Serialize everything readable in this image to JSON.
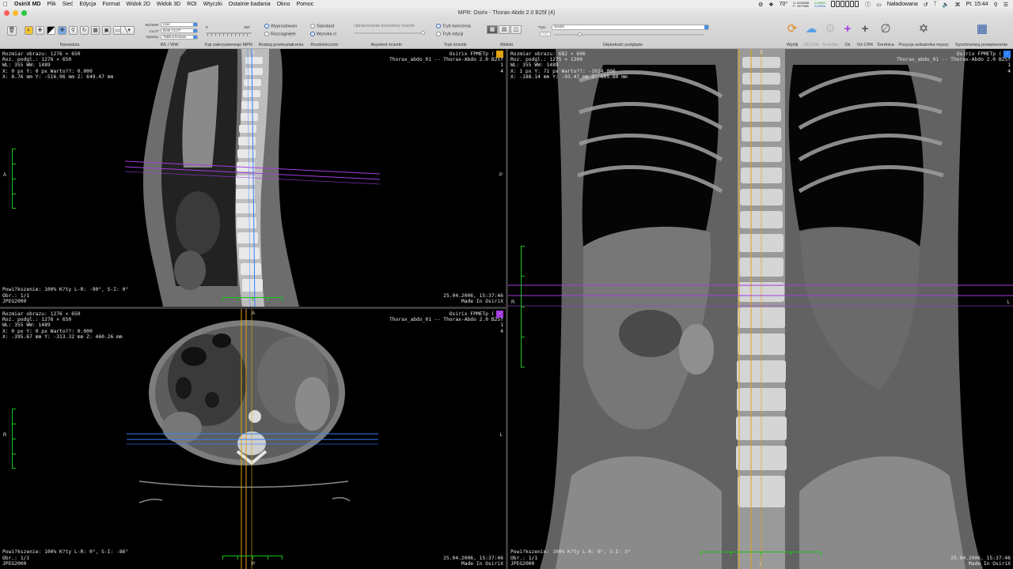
{
  "menubar": {
    "apple": "",
    "app": "OsiriX MD",
    "items": [
      "Plik",
      "Sieć",
      "Edycja",
      "Format",
      "Widok 2D",
      "Widok 3D",
      "ROI",
      "Wtyczki",
      "Ostatnie badania",
      "Okno",
      "Pomoc"
    ],
    "status": {
      "temperature": "70°",
      "mem_u": "U: 6220MB",
      "mem_f": "F: 1977MB",
      "net_up": "0,0KB/s",
      "net_down": "0,0KB/s",
      "battery": "Naładowana",
      "clock": "Pt. 15:44"
    }
  },
  "window": {
    "title": "MPR: Osirix - Thorax-Abdo 2.0 B25f (4)"
  },
  "toolbar": {
    "groups": {
      "tools": "Narzędzia",
      "wlww": "WL / WW",
      "mpr_angle": "Kąt zakrzywionego MPR",
      "resample": "Rodzaj przekształcenia",
      "resolution": "Rozdzielczość",
      "path_assistant": "Asystent ścieżki",
      "path_mode": "Tryb ścieżki",
      "views": "Widoki",
      "depth": "Głębokość podglądu",
      "export": "Wyślij",
      "dicom": "DICOM",
      "path": "Ścieżka",
      "axes": "Oś",
      "cpr_axis": "Oś CPR",
      "diameter": "Średnica",
      "mouse_pos": "Pozycja wskaźnika myszy",
      "sync": "Synchronizuj powiększenie"
    },
    "wlww": {
      "wlww_label": "WL/WW:",
      "wlww_value": "Inne",
      "clut_label": "CLUT:",
      "clut_value": "Brak CLUT",
      "opacity_label": "Opacity:",
      "opacity_value": "Tablica liniowa"
    },
    "slider": {
      "min": "0",
      "max": "360"
    },
    "resample": {
      "opt1": "Wyprostowan",
      "opt2": "Rozciągnięte"
    },
    "resolution": {
      "opt1": "Standard",
      "opt2": "Wysoka rc"
    },
    "path_assistant_text": "Upraszczanie krzywizny ścieżki",
    "path_mode": {
      "opt1": "Tryb tworzenia",
      "opt2": "Tryb edycji"
    },
    "depth": {
      "mode_label": "Tryb:",
      "mode_value": "Średni",
      "sub_value": "mm"
    }
  },
  "viewports": {
    "sagittal": {
      "tl": "Rozmiar obrazu: 1276 × 650\nRoz. podgl.: 1276 × 650\nWL: 355 WW: 1489\nX: 0 px Y: 0 px Warto??: 0.000\nX: 8.76 mm Y: -516.96 mm Z: 649.47 mm",
      "tr": "Osirix FPMETp ( -,\nThorax_abdo_01 -- Thorax-Abdo 2.0 B25f\n1\n4",
      "bl": "Powi?kszenie: 100% K?ty L-R: -90°, S-I: 0°\nObr.: 1/1\nJPEG2000",
      "br": "25.04.2006, 15:37:46\nMade In OsiriX",
      "top": "S",
      "left": "A",
      "right": "P",
      "bottom": "I"
    },
    "axial": {
      "tl": "Rozmiar obrazu: 1276 × 650\nRoz. podgl.: 1276 × 650\nWL: 355 WW: 1489\nX: 0 px Y: 0 px Warto??: 0.000\nX: -395.67 mm Y: -313.32 mm Z: 460.26 mm",
      "tr": "Osirix FPMETp ( -,\nThorax_abdo_01 -- Thorax-Abdo 2.0 B25f\n1\n4",
      "bl": "Powi?kszenie: 100% K?ty L-R: 0°, S-I: -86°\nObr.: 1/1\nJPEG2000",
      "br": "25.04.2006, 15:37:46\nMade In OsiriX",
      "top": "A",
      "left": "R",
      "right": "L",
      "bottom": "P"
    },
    "coronal": {
      "tl": "Rozmiar obrazu: 682 × 696\nRoz. podgl.: 1275 × 1300\nWL: 355 WW: 1489\nX: 1 px Y: 71 px Warto??: -1024.000\nX: -188.14 mm Y: -93.47 mm Z: 605.80 mm",
      "tr": "Osirix FPMETp ( -,\nThorax_abdo_01 -- Thorax-Abdo 2.0 B25f\n1\n4",
      "bl": "Powi?kszenie: 100% K?ty L-R: 0°, S-I: 3°\nObr.: 1/1\nJPEG2000",
      "br": "25.04.2006, 15:37:46\nMade In OsiriX",
      "top": "S",
      "left": "R",
      "right": "L",
      "bottom": "I"
    }
  },
  "colors": {
    "axis_orange": "#e2a20c",
    "axis_purple": "#a43ce0",
    "axis_blue": "#2f80ff",
    "scale_green": "#19c419"
  }
}
